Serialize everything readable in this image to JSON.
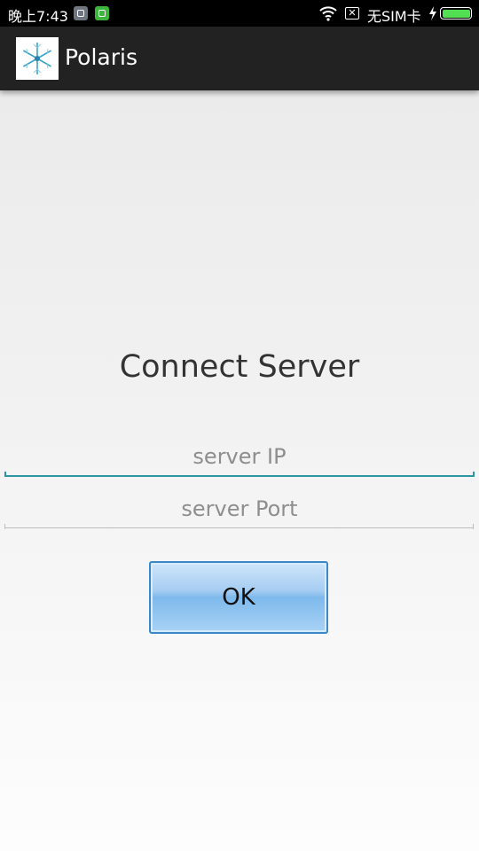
{
  "status_bar": {
    "time": "晚上7:43",
    "carrier": "无SIM卡",
    "notification_icons": [
      "notification-app-icon",
      "android-icon"
    ],
    "icons": [
      "wifi-icon",
      "no-sim-icon",
      "charging-icon",
      "battery-icon"
    ],
    "battery_color": "#52e052"
  },
  "action_bar": {
    "title": "Polaris",
    "logo_icon": "snowflake-logo-icon",
    "background": "#222222"
  },
  "main": {
    "heading": "Connect Server",
    "server_ip": {
      "value": "",
      "placeholder": "server IP",
      "focused": true,
      "accent_color": "#2a97a3"
    },
    "server_port": {
      "value": "",
      "placeholder": "server Port"
    },
    "ok_button": {
      "label": "OK",
      "color": "#7eb9ec"
    }
  }
}
